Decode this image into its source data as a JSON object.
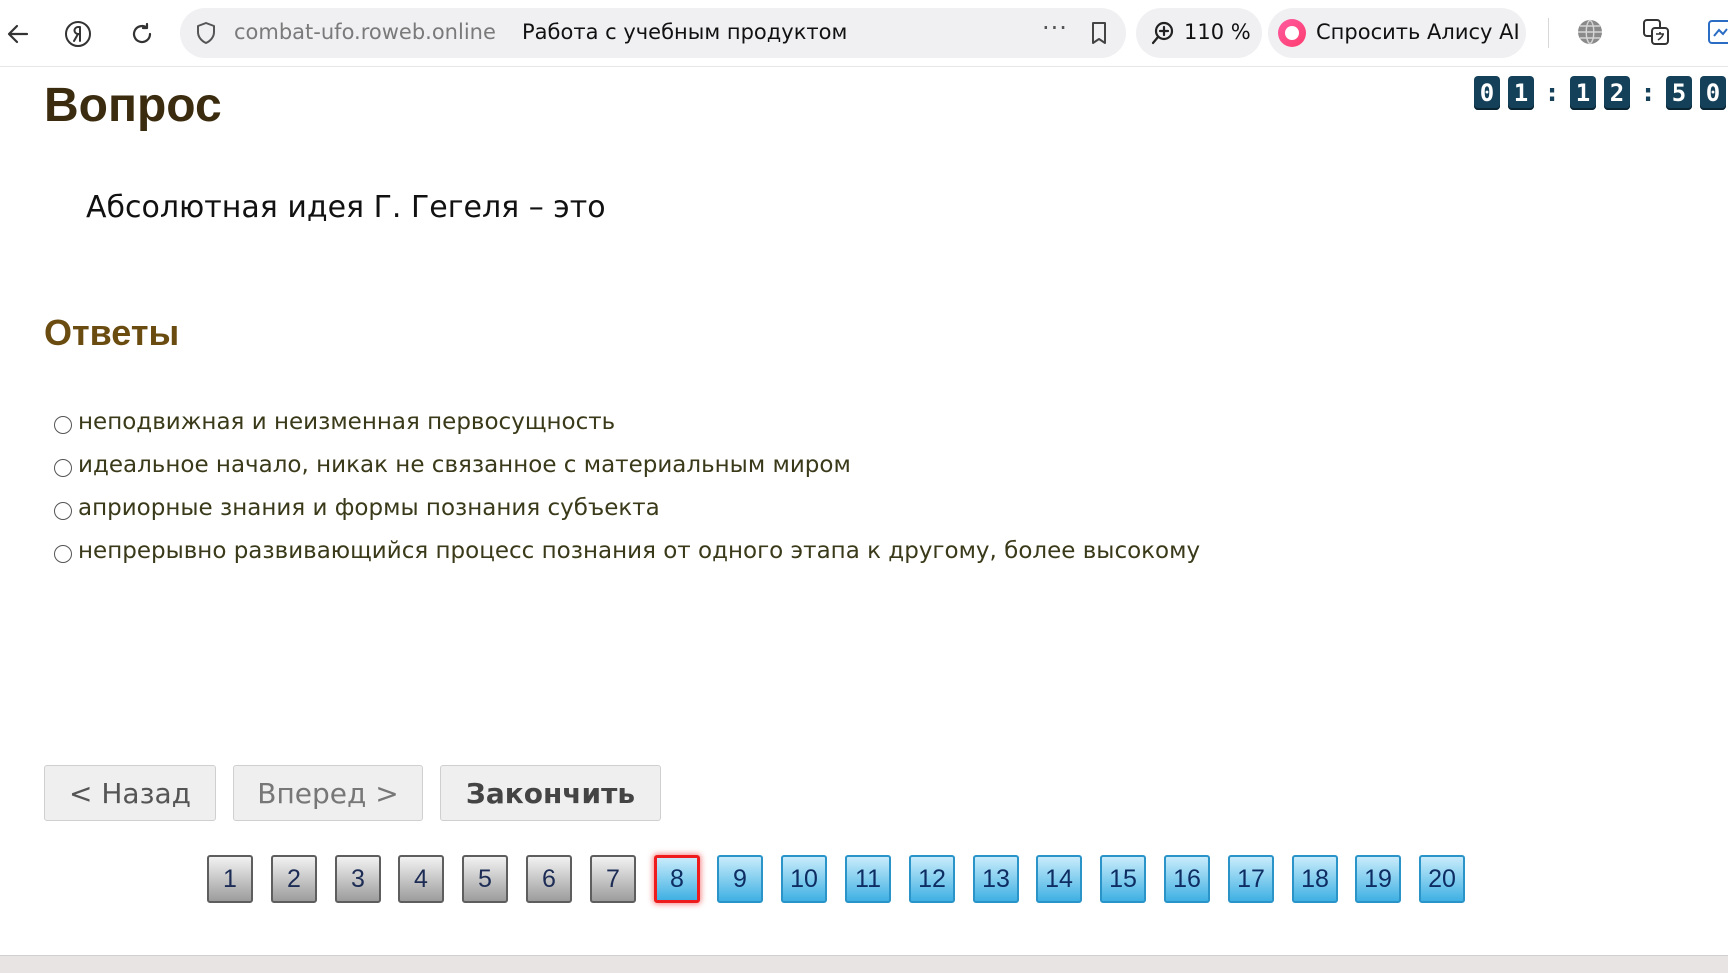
{
  "browser": {
    "domain": "combat-ufo.roweb.online",
    "page_title": "Работа с учебным продуктом",
    "more_label": "···",
    "zoom": "110 %",
    "alice_label": "Спросить Алису AI"
  },
  "timer": {
    "digits": [
      "0",
      "1",
      "1",
      "2",
      "5",
      "0"
    ],
    "separator": ":"
  },
  "question": {
    "heading": "Вопрос",
    "text": "Абсолютная идея Г. Гегеля – это"
  },
  "answers": {
    "heading": "Ответы",
    "items": [
      {
        "label": "неподвижная и неизменная первосущность",
        "selected": false
      },
      {
        "label": "идеальное начало, никак не связанное с материальным миром",
        "selected": false
      },
      {
        "label": "априорные знания и формы познания субъекта",
        "selected": false
      },
      {
        "label": "непрерывно развивающийся процесс познания от одного этапа к другому, более высокому",
        "selected": false
      }
    ]
  },
  "buttons": {
    "back": "< Назад",
    "forward": "Вперед >",
    "finish": "Закончить"
  },
  "pager": {
    "current": 8,
    "pages": [
      "1",
      "2",
      "3",
      "4",
      "5",
      "6",
      "7",
      "8",
      "9",
      "10",
      "11",
      "12",
      "13",
      "14",
      "15",
      "16",
      "17",
      "18",
      "19",
      "20"
    ],
    "colors": {
      "done": "#9c9c9c",
      "todo": "#3fb0e3",
      "current_border": "#ee1c1c"
    }
  }
}
